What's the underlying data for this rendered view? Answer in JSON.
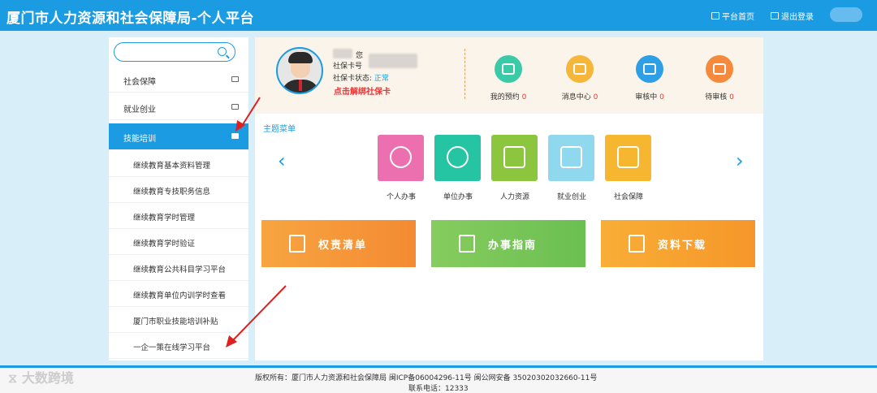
{
  "header": {
    "title": "厦门市人力资源和社会保障局-个人平台",
    "home_link": "平台首页",
    "logout_link": "退出登录"
  },
  "sidebar": {
    "search_placeholder": "",
    "menu": [
      {
        "label": "社会保障"
      },
      {
        "label": "就业创业"
      },
      {
        "label": "技能培训",
        "active": true
      }
    ],
    "sub_items": [
      "继续教育基本资料管理",
      "继续教育专技职务信息",
      "继续教育学时管理",
      "继续教育学时验证",
      "继续教育公共科目学习平台",
      "继续教育单位内训学时查看",
      "厦门市职业技能培训补贴",
      "一企一策在线学习平台"
    ]
  },
  "profile": {
    "greeting_suffix": "您",
    "card_label": "社保卡号",
    "card_status_label": "社保卡状态:",
    "card_status_value": "正常",
    "unbind_link": "点击解绑社保卡",
    "stats": [
      {
        "label": "我的预约",
        "count": "0",
        "color": "#3bcaa8",
        "icon": "phone-icon"
      },
      {
        "label": "消息中心",
        "count": "0",
        "color": "#f6b63a",
        "icon": "mail-icon"
      },
      {
        "label": "审核中",
        "count": "0",
        "color": "#2d9fe6",
        "icon": "calendar-icon"
      },
      {
        "label": "待审核",
        "count": "0",
        "color": "#f58a3c",
        "icon": "clipboard-icon"
      }
    ]
  },
  "theme_menu": {
    "title": "主题菜单",
    "tiles": [
      {
        "label": "个人办事",
        "color": "#ec6fb0",
        "icon": "baby-face-icon"
      },
      {
        "label": "单位办事",
        "color": "#25c4a3",
        "icon": "lightbulb-icon"
      },
      {
        "label": "人力资源",
        "color": "#8cc63f",
        "icon": "briefcase-icon"
      },
      {
        "label": "就业创业",
        "color": "#8fd8ee",
        "icon": "id-card-icon"
      },
      {
        "label": "社会保障",
        "color": "#f6b630",
        "icon": "graduation-cap-icon"
      }
    ]
  },
  "banners": [
    {
      "label": "权责清单",
      "color": "#f79b3a",
      "icon": "document-list-icon"
    },
    {
      "label": "办事指南",
      "color": "#7cc65a",
      "icon": "guide-icon"
    },
    {
      "label": "资料下载",
      "color": "#f7a030",
      "icon": "download-icon"
    }
  ],
  "footer": {
    "line1": "版权所有：厦门市人力资源和社会保障局    闽ICP备06004296-11号    闽公网安备 35020302032660-11号",
    "line2": "联系电话：12333"
  },
  "watermark": "大数跨境"
}
